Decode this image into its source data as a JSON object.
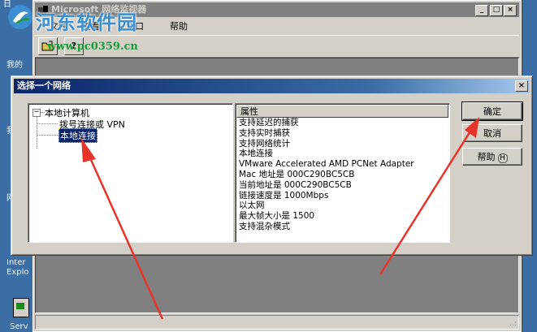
{
  "desktop": {
    "labels": [
      "日",
      "我的",
      "我",
      "网",
      "Inter",
      "Explo",
      "Serv"
    ]
  },
  "app": {
    "title": "Microsoft 网络监视器",
    "menu": [
      "文件",
      "查看",
      "窗口",
      "帮助"
    ],
    "toolbar": [
      "?"
    ],
    "window_buttons": [
      "_",
      "□",
      "×"
    ],
    "status": "..:"
  },
  "watermark": {
    "name": "河东软件园",
    "url": "www.pc0359.cn"
  },
  "dialog": {
    "title": "选择一个网络",
    "close": "×",
    "tree": {
      "expander": "−",
      "root": "本地计算机",
      "children": [
        "拨号连接或 VPN",
        "本地连接"
      ]
    },
    "properties": {
      "header": "属性",
      "lines": [
        "支持延迟的捕获",
        "支持实时捕获",
        "支持网络统计",
        "本地连接",
        "VMware Accelerated AMD PCNet Adapter",
        "Mac 地址是 000C290BC5CB",
        "当前地址是 000C290BC5CB",
        "链接速度是 1000Mbps",
        "以太网",
        "最大帧大小是 1500",
        "支持混杂模式"
      ]
    },
    "buttons": {
      "ok": "确定",
      "cancel": "取消",
      "help": "帮助",
      "help_key": "H"
    }
  },
  "colors": {
    "desktop": "#3a6ea5",
    "title_active": "#0a246a",
    "arrow": "#e8332a",
    "watermark_blue": "#3b8fd0",
    "watermark_green": "#1a9a3a"
  }
}
